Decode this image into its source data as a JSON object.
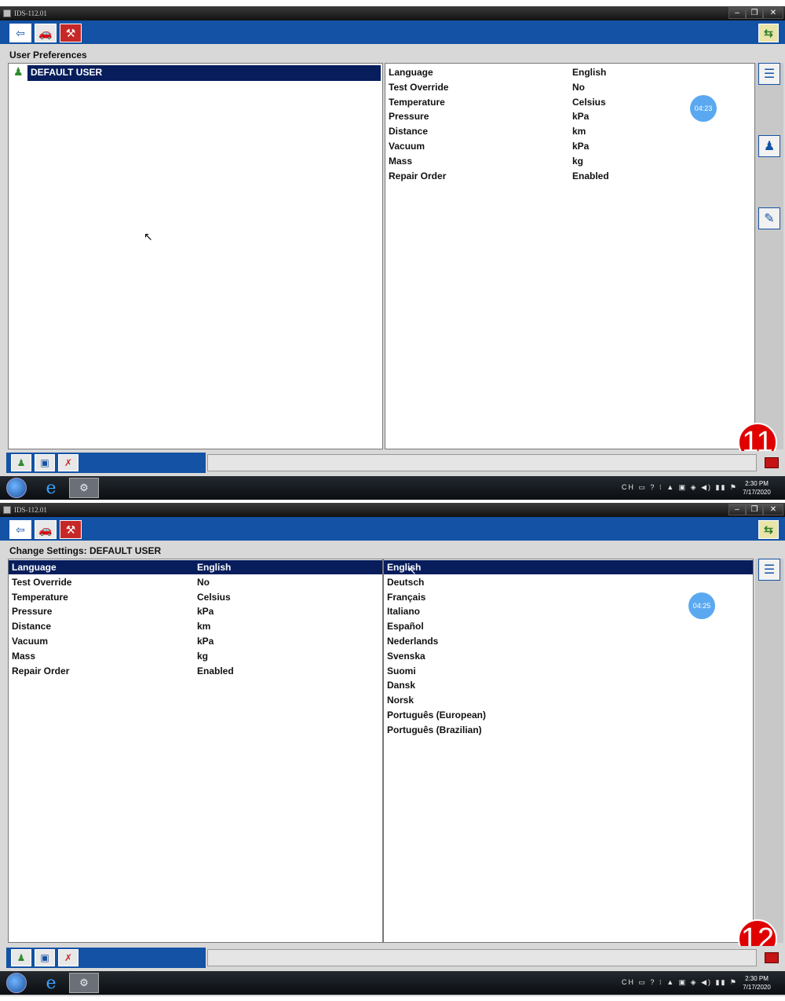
{
  "window_title": "IDS-112.01",
  "screen1": {
    "section_title": "User Preferences",
    "user_list": [
      "DEFAULT USER"
    ],
    "settings": [
      {
        "key": "Language",
        "value": "English"
      },
      {
        "key": "Test Override",
        "value": "No"
      },
      {
        "key": "Temperature",
        "value": "Celsius"
      },
      {
        "key": "Pressure",
        "value": "kPa"
      },
      {
        "key": "Distance",
        "value": "km"
      },
      {
        "key": "Vacuum",
        "value": "kPa"
      },
      {
        "key": "Mass",
        "value": "kg"
      },
      {
        "key": "Repair Order",
        "value": "Enabled"
      }
    ],
    "timer": "04:23",
    "step_badge": "11",
    "clock_time": "2:30 PM",
    "clock_date": "7/17/2020"
  },
  "screen2": {
    "section_title": "Change Settings:  DEFAULT USER",
    "settings": [
      {
        "key": "Language",
        "value": "English"
      },
      {
        "key": "Test Override",
        "value": "No"
      },
      {
        "key": "Temperature",
        "value": "Celsius"
      },
      {
        "key": "Pressure",
        "value": "kPa"
      },
      {
        "key": "Distance",
        "value": "km"
      },
      {
        "key": "Vacuum",
        "value": "kPa"
      },
      {
        "key": "Mass",
        "value": "kg"
      },
      {
        "key": "Repair Order",
        "value": "Enabled"
      }
    ],
    "language_options": [
      "English",
      "Deutsch",
      "Français",
      "Italiano",
      "Español",
      "Nederlands",
      "Svenska",
      "Suomi",
      "Dansk",
      "Norsk",
      "Português (European)",
      "Português (Brazilian)"
    ],
    "timer": "04:25",
    "step_badge": "12",
    "clock_time": "2:30 PM",
    "clock_date": "7/17/2020"
  },
  "window_controls": {
    "minimize": "–",
    "restore": "❐",
    "close": "✕"
  },
  "taskbar": {
    "tray_text": "CH ▭ ? ⁝ ▲ ▣ ◈ ◀) ▮▮ ⚑"
  },
  "colors": {
    "toolbar_blue": "#1352a4",
    "selection_navy": "#071d5c",
    "badge_red": "#e00000",
    "timer_blue": "#5aa9f0"
  }
}
